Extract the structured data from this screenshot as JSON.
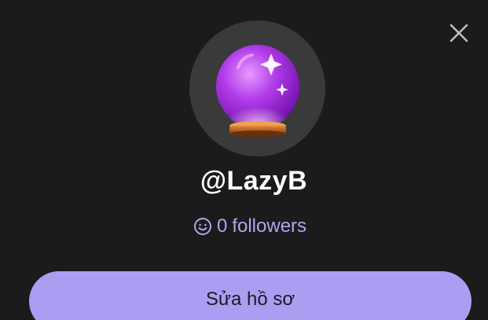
{
  "profile": {
    "username": "@LazyB",
    "followers_count": "0",
    "followers_label": "followers",
    "avatar_icon": "crystal-ball-icon"
  },
  "actions": {
    "edit_profile_label": "Sửa hồ sơ",
    "close_icon": "close-icon"
  },
  "colors": {
    "background": "#1b1b1c",
    "avatar_bg": "#3a3a3b",
    "accent": "#ab9ef2",
    "followers_text": "#b3a3f0",
    "text": "#ffffff"
  }
}
